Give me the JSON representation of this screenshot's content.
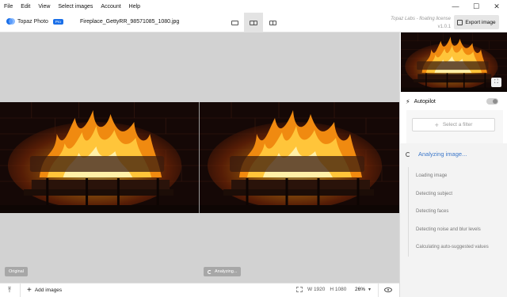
{
  "menu": [
    "File",
    "Edit",
    "View",
    "Select images",
    "Account",
    "Help"
  ],
  "window_controls": {
    "minimize": "—",
    "maximize": "☐",
    "close": "✕"
  },
  "toolbar": {
    "app_name": "Topaz Photo",
    "badge": "Pro",
    "filename": "Fireplace_GettyRR_98571085_1080.jpg",
    "license": "Topaz Labs - floating license",
    "version": "v1.0.1",
    "export_label": "Export image"
  },
  "canvas": {
    "original_label": "Original",
    "analyzing_label": "Analyzing..."
  },
  "bottombar": {
    "upload_icon": "⤒",
    "add_images": "Add images",
    "width": "W 1920",
    "height": "H 1080",
    "zoom": "26%"
  },
  "panel": {
    "autopilot_label": "Autopilot",
    "select_filter": "Select a filter",
    "analyzing_title": "Analyzing image...",
    "steps": [
      "Loading image",
      "Detecting subject",
      "Detecting faces",
      "Detecting noise and blur levels",
      "Calculating auto-suggested values"
    ]
  },
  "colors": {
    "accent": "#1a6fe8",
    "analyzing_text": "#3a76c9",
    "canvas_bg": "#d2d2d2"
  }
}
